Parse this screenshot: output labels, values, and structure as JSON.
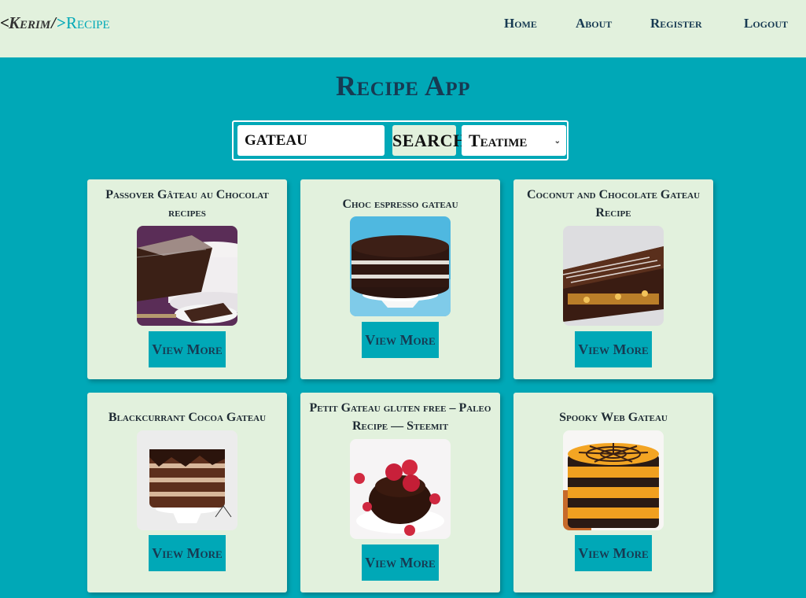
{
  "brand": {
    "open": "<",
    "name": "Kerim",
    "slash": "/",
    "close": ">",
    "app": "Recipe"
  },
  "nav": {
    "home": "Home",
    "about": "About",
    "register": "Register",
    "logout": "Logout"
  },
  "title": "Recipe App",
  "search": {
    "value": "gateau",
    "button": "search",
    "select": "Teatime"
  },
  "cards": [
    {
      "title": "Passover Gâteau au Chocolat recipes",
      "image": "chocolate-gateau-slice",
      "button": "View More"
    },
    {
      "title": "Choc espresso gateau",
      "image": "layered-chocolate-cake",
      "button": "View More"
    },
    {
      "title": "Coconut and Chocolate Gateau Recipe",
      "image": "coconut-chocolate-gateau",
      "button": "View More"
    },
    {
      "title": "Blackcurrant Cocoa Gateau",
      "image": "tall-layered-cocoa-cake",
      "button": "View More"
    },
    {
      "title": "Petit Gateau gluten free – Paleo Recipe — Steemit",
      "image": "raspberry-petit-gateau",
      "button": "View More"
    },
    {
      "title": "Spooky Web Gateau",
      "image": "spiderweb-orange-cake",
      "button": "View More"
    }
  ]
}
